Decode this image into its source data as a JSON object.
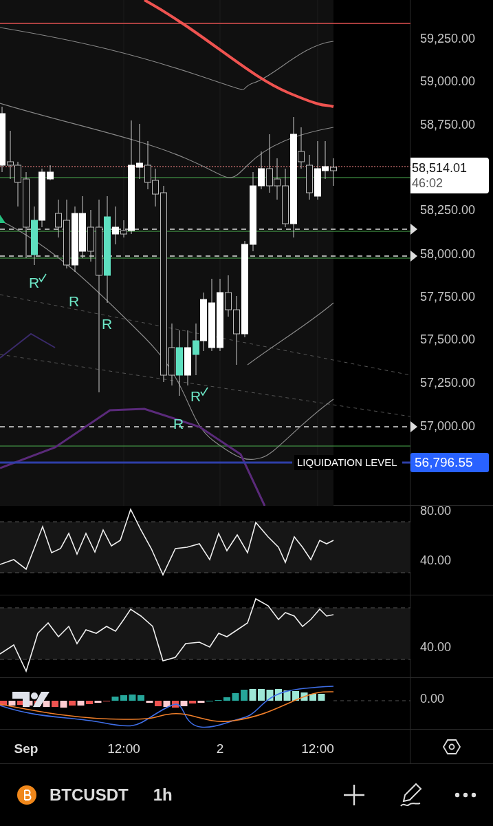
{
  "price_axis": {
    "labels": [
      "59,250.00",
      "59,000.00",
      "58,750.00",
      "58,250.00",
      "58,000.00",
      "57,750.00",
      "57,500.00",
      "57,250.00",
      "57,000.00"
    ],
    "current_price": "58,514.01",
    "countdown": "46:02"
  },
  "liquidation": {
    "label": "LIQUIDATION LEVEL",
    "price": "56,796.55"
  },
  "signals": [
    {
      "text": "R",
      "checked": true
    },
    {
      "text": "R",
      "checked": false
    },
    {
      "text": "R",
      "checked": false
    },
    {
      "text": "R",
      "checked": true
    },
    {
      "text": "R",
      "checked": false
    }
  ],
  "oscillator_1": {
    "labels": [
      "80.00",
      "40.00"
    ]
  },
  "oscillator_2": {
    "labels": [
      "40.00"
    ]
  },
  "macd": {
    "labels": [
      "0.00"
    ]
  },
  "time_axis": [
    "Sep",
    "12:00",
    "2",
    "12:00"
  ],
  "symbol_bar": {
    "symbol": "BTCUSDT",
    "interval": "1h"
  }
}
